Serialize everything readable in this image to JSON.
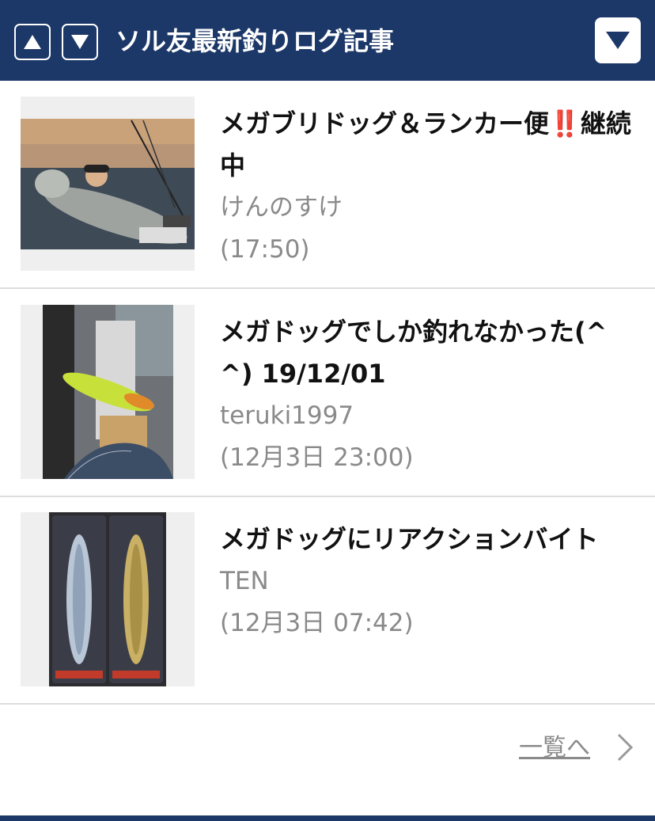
{
  "header": {
    "title": "ソル友最新釣りログ記事",
    "up_icon": "triangle-up-icon",
    "down_icon": "triangle-down-icon",
    "menu_icon": "dropdown-triangle-icon",
    "background_color": "#1c3868"
  },
  "articles": [
    {
      "title": "メガブリドッグ＆ランカー便‼️継続中",
      "author": "けんのすけ",
      "time": "(17:50)",
      "thumbnail": "angler-holding-large-fish-photo"
    },
    {
      "title": "メガドッグでしか釣れなかった(^^) 19/12/01",
      "author": "teruki1997",
      "time": "(12月3日 23:00)",
      "thumbnail": "yellow-lure-in-fish-mouth-photo"
    },
    {
      "title": "メガドッグにリアクションバイト",
      "author": "TEN",
      "time": "(12月3日 07:42)",
      "thumbnail": "megadog-lure-packages-photo"
    }
  ],
  "footer": {
    "more_label": "一覧へ",
    "more_icon": "chevron-right-icon"
  }
}
